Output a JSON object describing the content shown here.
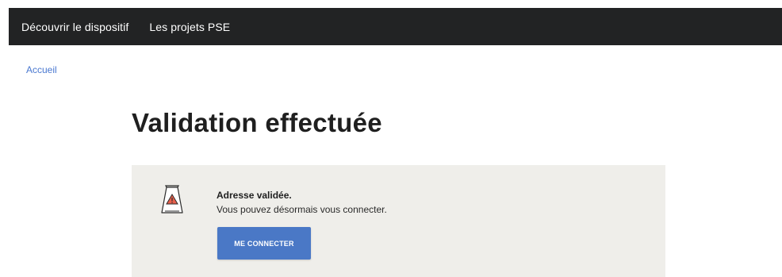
{
  "nav": {
    "items": [
      {
        "label": "Découvrir le dispositif"
      },
      {
        "label": "Les projets PSE"
      }
    ]
  },
  "breadcrumb": {
    "home": "Accueil"
  },
  "page": {
    "title": "Validation effectuée"
  },
  "notice": {
    "icon": "warning-sign-icon",
    "title": "Adresse validée.",
    "text": "Vous pouvez désormais vous connecter.",
    "button_label": "ME CONNECTER"
  },
  "colors": {
    "nav_background": "#222324",
    "link": "#4a78d0",
    "notice_background": "#efeeea",
    "button": "#4a78c6",
    "warning_fill": "#e8604c"
  }
}
